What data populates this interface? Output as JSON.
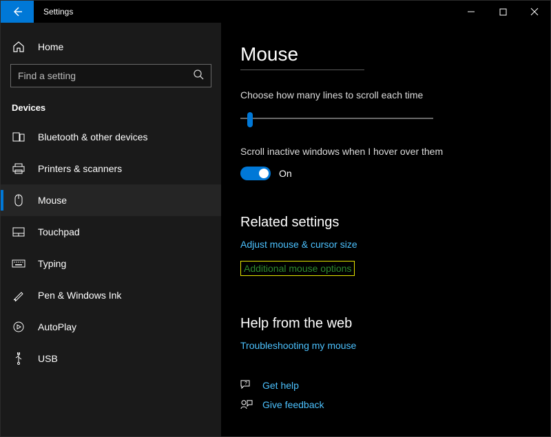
{
  "window": {
    "app_title": "Settings"
  },
  "sidebar": {
    "home_label": "Home",
    "search_placeholder": "Find a setting",
    "section_header": "Devices",
    "items": [
      {
        "label": "Bluetooth & other devices"
      },
      {
        "label": "Printers & scanners"
      },
      {
        "label": "Mouse"
      },
      {
        "label": "Touchpad"
      },
      {
        "label": "Typing"
      },
      {
        "label": "Pen & Windows Ink"
      },
      {
        "label": "AutoPlay"
      },
      {
        "label": "USB"
      }
    ]
  },
  "page": {
    "title": "Mouse",
    "scroll_label": "Choose how many lines to scroll each time",
    "inactive_label": "Scroll inactive windows when I hover over them",
    "toggle_state": "On",
    "related_header": "Related settings",
    "link_adjust": "Adjust mouse & cursor size",
    "link_additional": "Additional mouse options",
    "help_header": "Help from the web",
    "link_troubleshoot": "Troubleshooting my mouse",
    "link_get_help": "Get help",
    "link_feedback": "Give feedback"
  }
}
